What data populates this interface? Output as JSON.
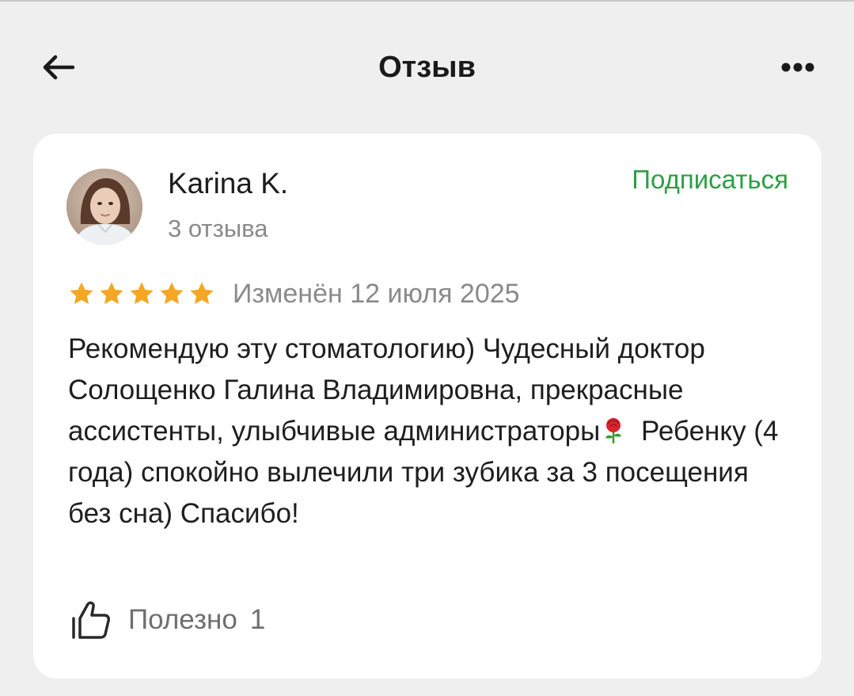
{
  "header": {
    "title": "Отзыв",
    "back_icon": "arrow-left-icon",
    "more_icon": "more-horizontal-icon"
  },
  "review": {
    "author": {
      "name": "Karina K.",
      "reviews_count": "3 отзыва",
      "avatar_icon": "user-avatar-photo"
    },
    "subscribe_label": "Подписаться",
    "rating": 5,
    "rating_max": 5,
    "date": "Изменён 12 июля 2025",
    "text_part1": "Рекомендую эту стоматологию) Чудесный доктор Солощенко Галина Владимировна, прекрасные ассистенты, улыбчивые администраторы",
    "text_emoji": "rose-emoji",
    "text_part2": "Ребенку (4 года) спокойно вылечили три зубика за 3 посещения без сна) Спасибо!",
    "helpful": {
      "label": "Полезно",
      "count": "1",
      "icon": "thumbs-up-icon"
    }
  },
  "colors": {
    "background": "#efefef",
    "card": "#ffffff",
    "accent_green": "#2d9e45",
    "star": "#f5a623",
    "muted_text": "#8a8a8a",
    "text": "#1e1e1e"
  }
}
